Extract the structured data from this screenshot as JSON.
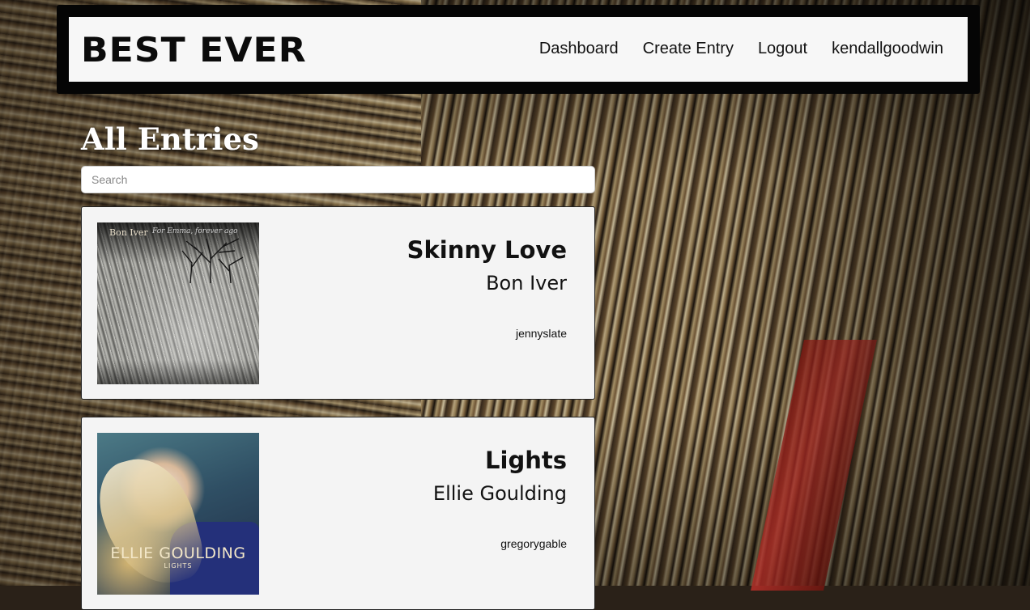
{
  "header": {
    "logo": "BEST EVER",
    "nav": [
      {
        "label": "Dashboard"
      },
      {
        "label": "Create Entry"
      },
      {
        "label": "Logout"
      },
      {
        "label": "kendallgoodwin"
      }
    ]
  },
  "main": {
    "title": "All Entries",
    "search": {
      "placeholder": "Search",
      "value": ""
    },
    "entries": [
      {
        "song": "Skinny Love",
        "artist": "Bon Iver",
        "user": "jennyslate",
        "art": {
          "band_text": "Bon Iver",
          "sub_text": "For Emma, forever ago"
        }
      },
      {
        "song": "Lights",
        "artist": "Ellie Goulding",
        "user": "gregorygable",
        "art": {
          "name_text": "ELLIE GOULDING",
          "album_text": "LIGHTS"
        }
      }
    ]
  }
}
